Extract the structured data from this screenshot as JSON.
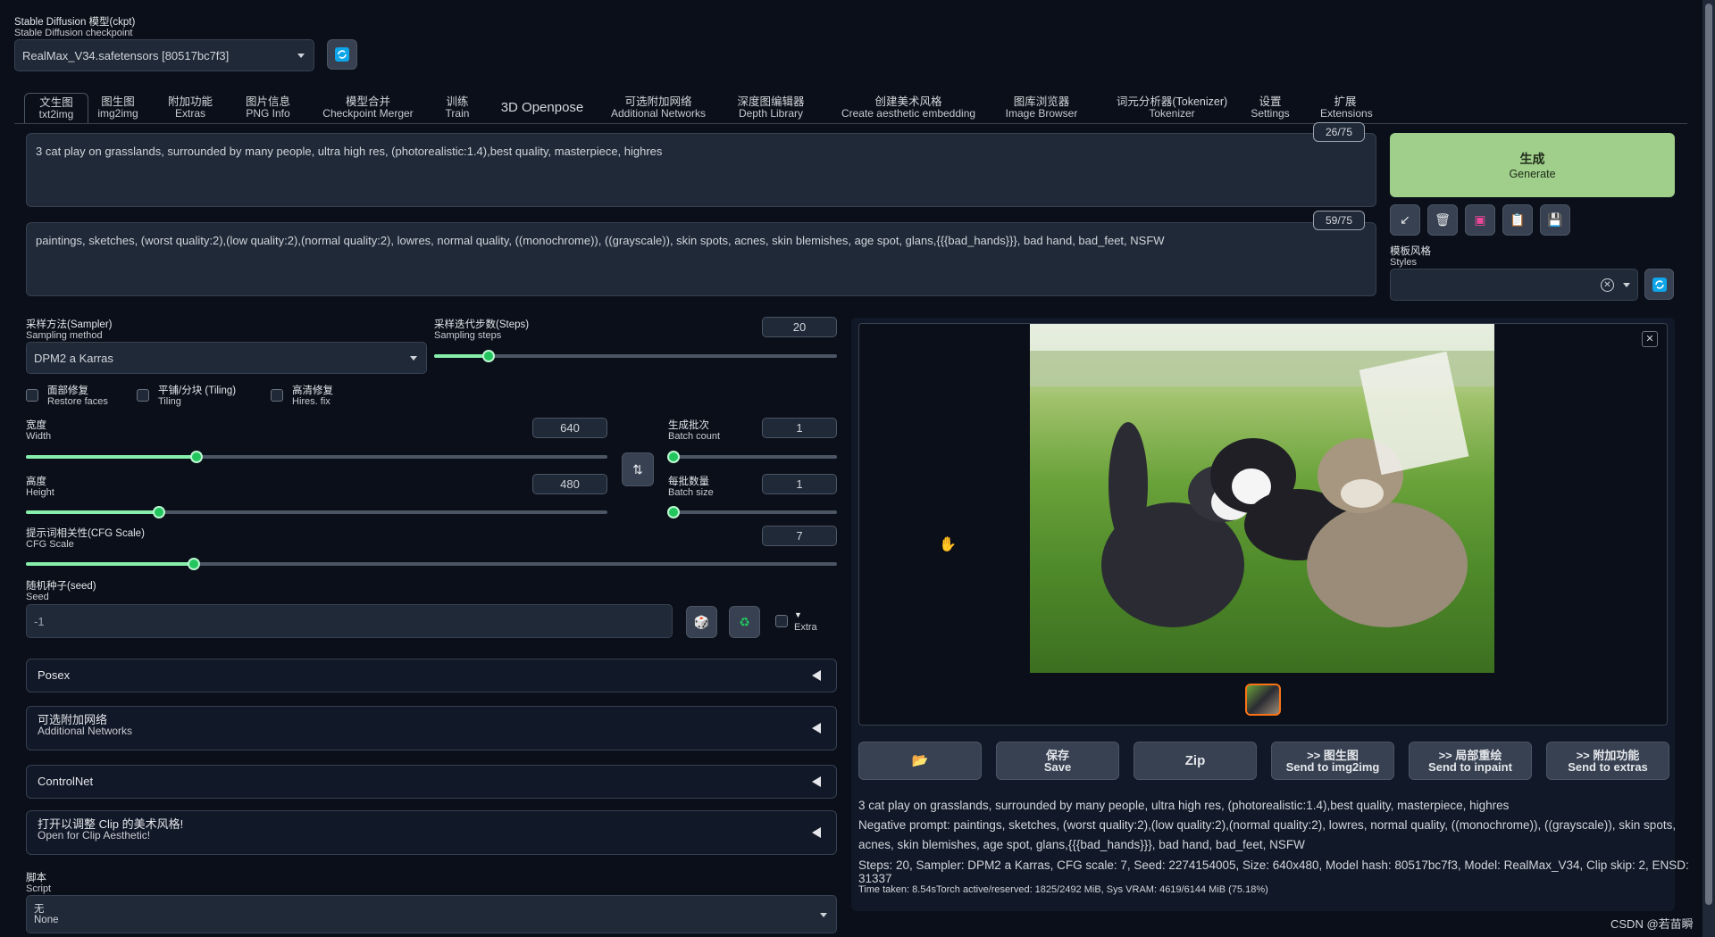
{
  "checkpoint": {
    "label_cn": "Stable Diffusion 模型(ckpt)",
    "label_en": "Stable Diffusion checkpoint",
    "value": "RealMax_V34.safetensors [80517bc7f3]"
  },
  "tabs": [
    {
      "cn": "文生图",
      "en": "txt2img",
      "active": true
    },
    {
      "cn": "图生图",
      "en": "img2img"
    },
    {
      "cn": "附加功能",
      "en": "Extras"
    },
    {
      "cn": "图片信息",
      "en": "PNG Info"
    },
    {
      "cn": "模型合并",
      "en": "Checkpoint Merger"
    },
    {
      "cn": "训练",
      "en": "Train"
    },
    {
      "cn": "3D Openpose",
      "en": ""
    },
    {
      "cn": "可选附加网络",
      "en": "Additional Networks"
    },
    {
      "cn": "深度图编辑器",
      "en": "Depth Library"
    },
    {
      "cn": "创建美术风格",
      "en": "Create aesthetic embedding"
    },
    {
      "cn": "图库浏览器",
      "en": "Image Browser"
    },
    {
      "cn": "词元分析器(Tokenizer)",
      "en": "Tokenizer"
    },
    {
      "cn": "设置",
      "en": "Settings"
    },
    {
      "cn": "扩展",
      "en": "Extensions"
    }
  ],
  "prompt": {
    "text": "3 cat play on grasslands, surrounded by many people, ultra high res, (photorealistic:1.4),best quality, masterpiece, highres",
    "counter": "26/75"
  },
  "negative_prompt": {
    "text": "paintings, sketches, (worst quality:2),(low quality:2),(normal quality:2), lowres, normal quality, ((monochrome)), ((grayscale)), skin spots, acnes, skin blemishes, age spot, glans,{{{bad_hands}}}, bad hand, bad_feet, NSFW",
    "counter": "59/75"
  },
  "generate": {
    "cn": "生成",
    "en": "Generate"
  },
  "tool_icons": [
    "arrow-icon",
    "trash-icon",
    "pink-card-icon",
    "clipboard-icon",
    "save-icon"
  ],
  "styles": {
    "label_cn": "模板风格",
    "label_en": "Styles",
    "value": ""
  },
  "sampler": {
    "label_cn": "采样方法(Sampler)",
    "label_en": "Sampling method",
    "value": "DPM2 a Karras"
  },
  "steps": {
    "label_cn": "采样迭代步数(Steps)",
    "label_en": "Sampling steps",
    "value": "20",
    "fraction": 0.136
  },
  "checkboxes": [
    {
      "cn": "面部修复",
      "en": "Restore faces"
    },
    {
      "cn": "平铺/分块 (Tiling)",
      "en": "Tiling"
    },
    {
      "cn": "高清修复",
      "en": "Hires. fix"
    }
  ],
  "width": {
    "label_cn": "宽度",
    "label_en": "Width",
    "value": "640",
    "fraction": 0.294
  },
  "height": {
    "label_cn": "高度",
    "label_en": "Height",
    "value": "480",
    "fraction": 0.229
  },
  "batch_count": {
    "label_cn": "生成批次",
    "label_en": "Batch count",
    "value": "1",
    "fraction": 0
  },
  "batch_size": {
    "label_cn": "每批数量",
    "label_en": "Batch size",
    "value": "1",
    "fraction": 0
  },
  "cfg": {
    "label_cn": "提示词相关性(CFG Scale)",
    "label_en": "CFG Scale",
    "value": "7",
    "fraction": 0.207
  },
  "seed": {
    "label_cn": "随机种子(seed)",
    "label_en": "Seed",
    "value": "-1",
    "extra": "Extra"
  },
  "accordions": [
    {
      "cn": "Posex",
      "en": ""
    },
    {
      "cn": "可选附加网络",
      "en": "Additional Networks"
    },
    {
      "cn": "ControlNet",
      "en": ""
    },
    {
      "cn": "打开以调整 Clip 的美术风格!",
      "en": "Open for Clip Aesthetic!"
    }
  ],
  "script": {
    "label_cn": "脚本",
    "label_en": "Script",
    "value_cn": "无",
    "value_en": "None"
  },
  "actions": [
    {
      "cn": "",
      "en": "",
      "icon": "folder-icon"
    },
    {
      "cn": "保存",
      "en": "Save"
    },
    {
      "cn": "Zip",
      "en": ""
    },
    {
      "cn": ">> 图生图",
      "en": "Send to img2img"
    },
    {
      "cn": ">> 局部重绘",
      "en": "Send to inpaint"
    },
    {
      "cn": ">> 附加功能",
      "en": "Send to extras"
    }
  ],
  "output_info": {
    "line1": "3 cat play on grasslands, surrounded by many people, ultra high res, (photorealistic:1.4),best quality, masterpiece, highres",
    "line2": "Negative prompt: paintings, sketches, (worst quality:2),(low quality:2),(normal quality:2), lowres, normal quality, ((monochrome)), ((grayscale)), skin spots,",
    "line3": "acnes, skin blemishes, age spot, glans,{{{bad_hands}}}, bad hand, bad_feet, NSFW",
    "line4": "Steps: 20, Sampler: DPM2 a Karras, CFG scale: 7, Seed: 2274154005, Size: 640x480, Model hash: 80517bc7f3, Model: RealMax_V34, Clip skip: 2, ENSD: 31337",
    "time": "Time taken: 8.54sTorch active/reserved: 1825/2492 MiB, Sys VRAM: 4619/6144 MiB (75.18%)"
  },
  "watermark": "CSDN @若苗瞬",
  "colors": {
    "generate_bg": "#9fcf8a",
    "accent_blue": "#0ea5e9",
    "slider": "#22c55e"
  }
}
